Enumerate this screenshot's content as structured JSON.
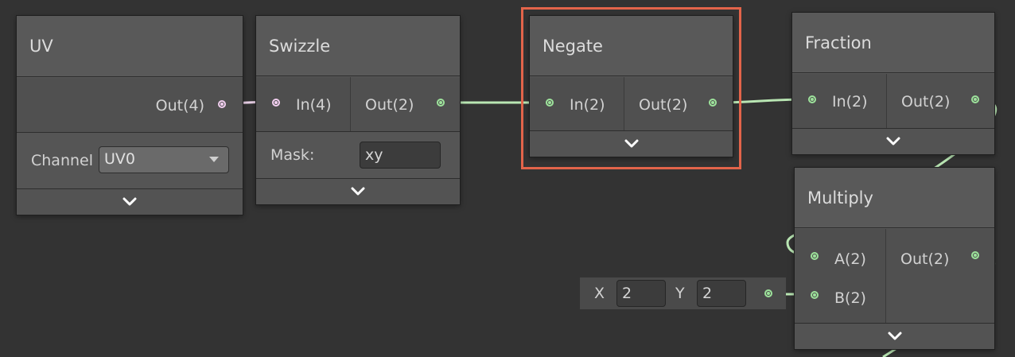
{
  "nodes": {
    "uv": {
      "title": "UV",
      "outputs": [
        {
          "label": "Out(4)",
          "type": "vector4"
        }
      ],
      "channel": {
        "label": "Channel",
        "value": "UV0"
      }
    },
    "swizzle": {
      "title": "Swizzle",
      "inputs": [
        {
          "label": "In(4)"
        }
      ],
      "outputs": [
        {
          "label": "Out(2)"
        }
      ],
      "mask": {
        "label": "Mask:",
        "value": "xy"
      }
    },
    "negate": {
      "title": "Negate",
      "inputs": [
        {
          "label": "In(2)"
        }
      ],
      "outputs": [
        {
          "label": "Out(2)"
        }
      ],
      "highlighted": true
    },
    "fraction": {
      "title": "Fraction",
      "inputs": [
        {
          "label": "In(2)"
        }
      ],
      "outputs": [
        {
          "label": "Out(2)"
        }
      ]
    },
    "multiply": {
      "title": "Multiply",
      "inputs": [
        {
          "label": "A(2)"
        },
        {
          "label": "B(2)"
        }
      ],
      "outputs": [
        {
          "label": "Out(2)"
        }
      ]
    }
  },
  "vector_input": {
    "x_label": "X",
    "x_value": "2",
    "y_label": "Y",
    "y_value": "2"
  },
  "colors": {
    "background": "#333333",
    "node": "#595959",
    "vector2_port": "#9de39b",
    "vector4_port": "#f2cff0",
    "highlight": "#e3644a"
  },
  "icons": {
    "collapse": "chevron-down-icon",
    "dropdown": "dropdown-arrow-icon"
  }
}
